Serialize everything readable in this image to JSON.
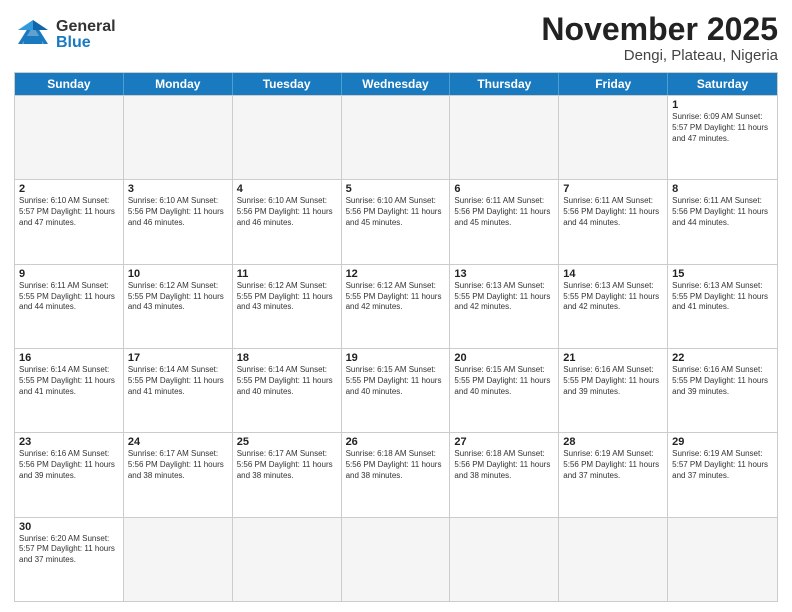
{
  "logo": {
    "general": "General",
    "blue": "Blue"
  },
  "title": "November 2025",
  "location": "Dengi, Plateau, Nigeria",
  "header_days": [
    "Sunday",
    "Monday",
    "Tuesday",
    "Wednesday",
    "Thursday",
    "Friday",
    "Saturday"
  ],
  "rows": [
    [
      {
        "day": "",
        "content": ""
      },
      {
        "day": "",
        "content": ""
      },
      {
        "day": "",
        "content": ""
      },
      {
        "day": "",
        "content": ""
      },
      {
        "day": "",
        "content": ""
      },
      {
        "day": "",
        "content": ""
      },
      {
        "day": "1",
        "content": "Sunrise: 6:09 AM\nSunset: 5:57 PM\nDaylight: 11 hours\nand 47 minutes."
      }
    ],
    [
      {
        "day": "2",
        "content": "Sunrise: 6:10 AM\nSunset: 5:57 PM\nDaylight: 11 hours\nand 47 minutes."
      },
      {
        "day": "3",
        "content": "Sunrise: 6:10 AM\nSunset: 5:56 PM\nDaylight: 11 hours\nand 46 minutes."
      },
      {
        "day": "4",
        "content": "Sunrise: 6:10 AM\nSunset: 5:56 PM\nDaylight: 11 hours\nand 46 minutes."
      },
      {
        "day": "5",
        "content": "Sunrise: 6:10 AM\nSunset: 5:56 PM\nDaylight: 11 hours\nand 45 minutes."
      },
      {
        "day": "6",
        "content": "Sunrise: 6:11 AM\nSunset: 5:56 PM\nDaylight: 11 hours\nand 45 minutes."
      },
      {
        "day": "7",
        "content": "Sunrise: 6:11 AM\nSunset: 5:56 PM\nDaylight: 11 hours\nand 44 minutes."
      },
      {
        "day": "8",
        "content": "Sunrise: 6:11 AM\nSunset: 5:56 PM\nDaylight: 11 hours\nand 44 minutes."
      }
    ],
    [
      {
        "day": "9",
        "content": "Sunrise: 6:11 AM\nSunset: 5:55 PM\nDaylight: 11 hours\nand 44 minutes."
      },
      {
        "day": "10",
        "content": "Sunrise: 6:12 AM\nSunset: 5:55 PM\nDaylight: 11 hours\nand 43 minutes."
      },
      {
        "day": "11",
        "content": "Sunrise: 6:12 AM\nSunset: 5:55 PM\nDaylight: 11 hours\nand 43 minutes."
      },
      {
        "day": "12",
        "content": "Sunrise: 6:12 AM\nSunset: 5:55 PM\nDaylight: 11 hours\nand 42 minutes."
      },
      {
        "day": "13",
        "content": "Sunrise: 6:13 AM\nSunset: 5:55 PM\nDaylight: 11 hours\nand 42 minutes."
      },
      {
        "day": "14",
        "content": "Sunrise: 6:13 AM\nSunset: 5:55 PM\nDaylight: 11 hours\nand 42 minutes."
      },
      {
        "day": "15",
        "content": "Sunrise: 6:13 AM\nSunset: 5:55 PM\nDaylight: 11 hours\nand 41 minutes."
      }
    ],
    [
      {
        "day": "16",
        "content": "Sunrise: 6:14 AM\nSunset: 5:55 PM\nDaylight: 11 hours\nand 41 minutes."
      },
      {
        "day": "17",
        "content": "Sunrise: 6:14 AM\nSunset: 5:55 PM\nDaylight: 11 hours\nand 41 minutes."
      },
      {
        "day": "18",
        "content": "Sunrise: 6:14 AM\nSunset: 5:55 PM\nDaylight: 11 hours\nand 40 minutes."
      },
      {
        "day": "19",
        "content": "Sunrise: 6:15 AM\nSunset: 5:55 PM\nDaylight: 11 hours\nand 40 minutes."
      },
      {
        "day": "20",
        "content": "Sunrise: 6:15 AM\nSunset: 5:55 PM\nDaylight: 11 hours\nand 40 minutes."
      },
      {
        "day": "21",
        "content": "Sunrise: 6:16 AM\nSunset: 5:55 PM\nDaylight: 11 hours\nand 39 minutes."
      },
      {
        "day": "22",
        "content": "Sunrise: 6:16 AM\nSunset: 5:55 PM\nDaylight: 11 hours\nand 39 minutes."
      }
    ],
    [
      {
        "day": "23",
        "content": "Sunrise: 6:16 AM\nSunset: 5:56 PM\nDaylight: 11 hours\nand 39 minutes."
      },
      {
        "day": "24",
        "content": "Sunrise: 6:17 AM\nSunset: 5:56 PM\nDaylight: 11 hours\nand 38 minutes."
      },
      {
        "day": "25",
        "content": "Sunrise: 6:17 AM\nSunset: 5:56 PM\nDaylight: 11 hours\nand 38 minutes."
      },
      {
        "day": "26",
        "content": "Sunrise: 6:18 AM\nSunset: 5:56 PM\nDaylight: 11 hours\nand 38 minutes."
      },
      {
        "day": "27",
        "content": "Sunrise: 6:18 AM\nSunset: 5:56 PM\nDaylight: 11 hours\nand 38 minutes."
      },
      {
        "day": "28",
        "content": "Sunrise: 6:19 AM\nSunset: 5:56 PM\nDaylight: 11 hours\nand 37 minutes."
      },
      {
        "day": "29",
        "content": "Sunrise: 6:19 AM\nSunset: 5:57 PM\nDaylight: 11 hours\nand 37 minutes."
      }
    ],
    [
      {
        "day": "30",
        "content": "Sunrise: 6:20 AM\nSunset: 5:57 PM\nDaylight: 11 hours\nand 37 minutes."
      },
      {
        "day": "",
        "content": ""
      },
      {
        "day": "",
        "content": ""
      },
      {
        "day": "",
        "content": ""
      },
      {
        "day": "",
        "content": ""
      },
      {
        "day": "",
        "content": ""
      },
      {
        "day": "",
        "content": ""
      }
    ]
  ]
}
